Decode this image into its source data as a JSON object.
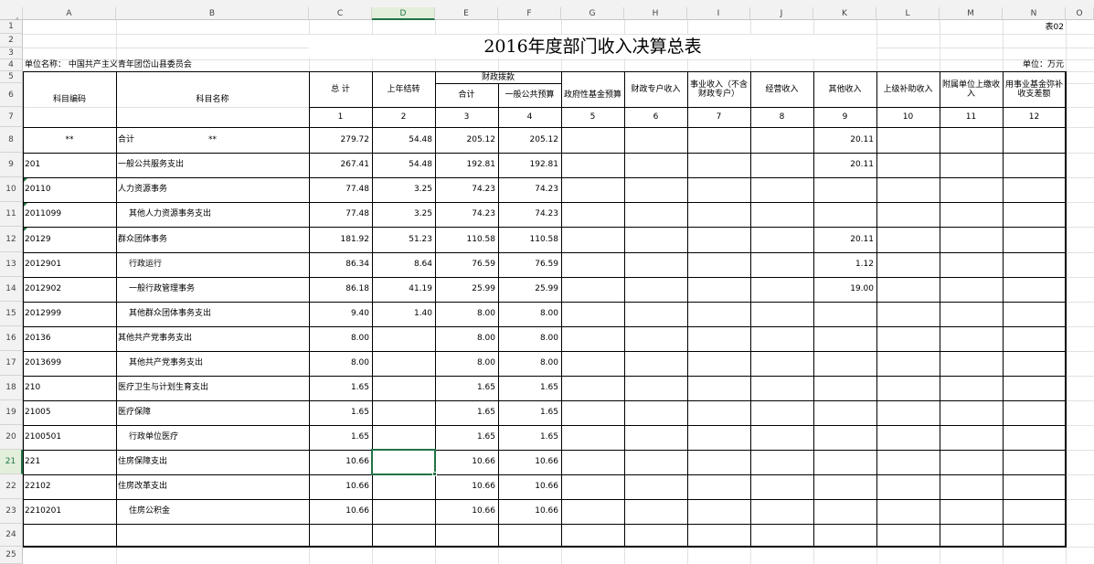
{
  "tabs": {
    "name_box": "D21",
    "formula_hint": "fx"
  },
  "columns": [
    "A",
    "B",
    "C",
    "D",
    "E",
    "F",
    "G",
    "H",
    "I",
    "J",
    "K",
    "L",
    "M",
    "N",
    "O"
  ],
  "rows": [
    "1",
    "2",
    "3",
    "4",
    "5",
    "6",
    "7",
    "8",
    "9",
    "10",
    "11",
    "12",
    "13",
    "14",
    "15",
    "16",
    "17",
    "18",
    "19",
    "20",
    "21",
    "22",
    "23",
    "24",
    "25"
  ],
  "sheet": {
    "title": "2016年度部门收入决算总表",
    "table_no": "表02",
    "unit_name": "单位名称：  中国共产主义青年团岱山县委员会",
    "unit_label": "单位：万元"
  },
  "headers": {
    "code": "科目编码",
    "name": "科目名称",
    "total": "总  计",
    "carryover": "上年结转",
    "fiscal_group": "财政拨款",
    "fiscal_sum": "合计",
    "general_budget": "一般公共预算",
    "gov_fund": "政府性基金预算",
    "special_fiscal": "财政专户收入",
    "business_income": "事业收入（不含财政专户）",
    "operating": "经营收入",
    "other": "其他收入",
    "superior_subsidy": "上级补助收入",
    "subordinate": "附属单位上缴收入",
    "fund_offset": "用事业基金弥补收支差额",
    "numbers": [
      "1",
      "2",
      "3",
      "4",
      "5",
      "6",
      "7",
      "8",
      "9",
      "10",
      "11",
      "12"
    ],
    "star_code": "**",
    "star_name": "**"
  },
  "data_rows": [
    {
      "code": "",
      "name": "合计",
      "indent": false,
      "total": "279.72",
      "carry": "54.48",
      "fsum": "205.12",
      "gen": "205.12",
      "other": "20.11",
      "mark": false
    },
    {
      "code": "201",
      "name": "一般公共服务支出",
      "indent": false,
      "total": "267.41",
      "carry": "54.48",
      "fsum": "192.81",
      "gen": "192.81",
      "other": "20.11",
      "mark": false
    },
    {
      "code": "20110",
      "name": "人力资源事务",
      "indent": false,
      "total": "77.48",
      "carry": "3.25",
      "fsum": "74.23",
      "gen": "74.23",
      "other": "",
      "mark": true
    },
    {
      "code": "2011099",
      "name": "其他人力资源事务支出",
      "indent": true,
      "total": "77.48",
      "carry": "3.25",
      "fsum": "74.23",
      "gen": "74.23",
      "other": "",
      "mark": true
    },
    {
      "code": "20129",
      "name": "群众团体事务",
      "indent": false,
      "total": "181.92",
      "carry": "51.23",
      "fsum": "110.58",
      "gen": "110.58",
      "other": "20.11",
      "mark": true
    },
    {
      "code": "2012901",
      "name": "行政运行",
      "indent": true,
      "total": "86.34",
      "carry": "8.64",
      "fsum": "76.59",
      "gen": "76.59",
      "other": "1.12",
      "mark": false
    },
    {
      "code": "2012902",
      "name": "一般行政管理事务",
      "indent": true,
      "total": "86.18",
      "carry": "41.19",
      "fsum": "25.99",
      "gen": "25.99",
      "other": "19.00",
      "mark": false
    },
    {
      "code": "2012999",
      "name": "其他群众团体事务支出",
      "indent": true,
      "total": "9.40",
      "carry": "1.40",
      "fsum": "8.00",
      "gen": "8.00",
      "other": "",
      "mark": false
    },
    {
      "code": "20136",
      "name": "其他共产党事务支出",
      "indent": false,
      "total": "8.00",
      "carry": "",
      "fsum": "8.00",
      "gen": "8.00",
      "other": "",
      "mark": false
    },
    {
      "code": "2013699",
      "name": "其他共产党事务支出",
      "indent": true,
      "total": "8.00",
      "carry": "",
      "fsum": "8.00",
      "gen": "8.00",
      "other": "",
      "mark": false
    },
    {
      "code": "210",
      "name": "医疗卫生与计划生育支出",
      "indent": false,
      "total": "1.65",
      "carry": "",
      "fsum": "1.65",
      "gen": "1.65",
      "other": "",
      "mark": false
    },
    {
      "code": "21005",
      "name": "医疗保障",
      "indent": false,
      "total": "1.65",
      "carry": "",
      "fsum": "1.65",
      "gen": "1.65",
      "other": "",
      "mark": false
    },
    {
      "code": "2100501",
      "name": "行政单位医疗",
      "indent": true,
      "total": "1.65",
      "carry": "",
      "fsum": "1.65",
      "gen": "1.65",
      "other": "",
      "mark": false
    },
    {
      "code": "221",
      "name": "住房保障支出",
      "indent": false,
      "total": "10.66",
      "carry": "",
      "fsum": "10.66",
      "gen": "10.66",
      "other": "",
      "mark": false
    },
    {
      "code": "22102",
      "name": "住房改革支出",
      "indent": false,
      "total": "10.66",
      "carry": "",
      "fsum": "10.66",
      "gen": "10.66",
      "other": "",
      "mark": false
    },
    {
      "code": "2210201",
      "name": "住房公积金",
      "indent": true,
      "total": "10.66",
      "carry": "",
      "fsum": "10.66",
      "gen": "10.66",
      "other": "",
      "mark": false
    }
  ],
  "colors": {
    "accent": "#217346",
    "grid": "#e1e1e1",
    "header_bg": "#f2f2f2"
  }
}
